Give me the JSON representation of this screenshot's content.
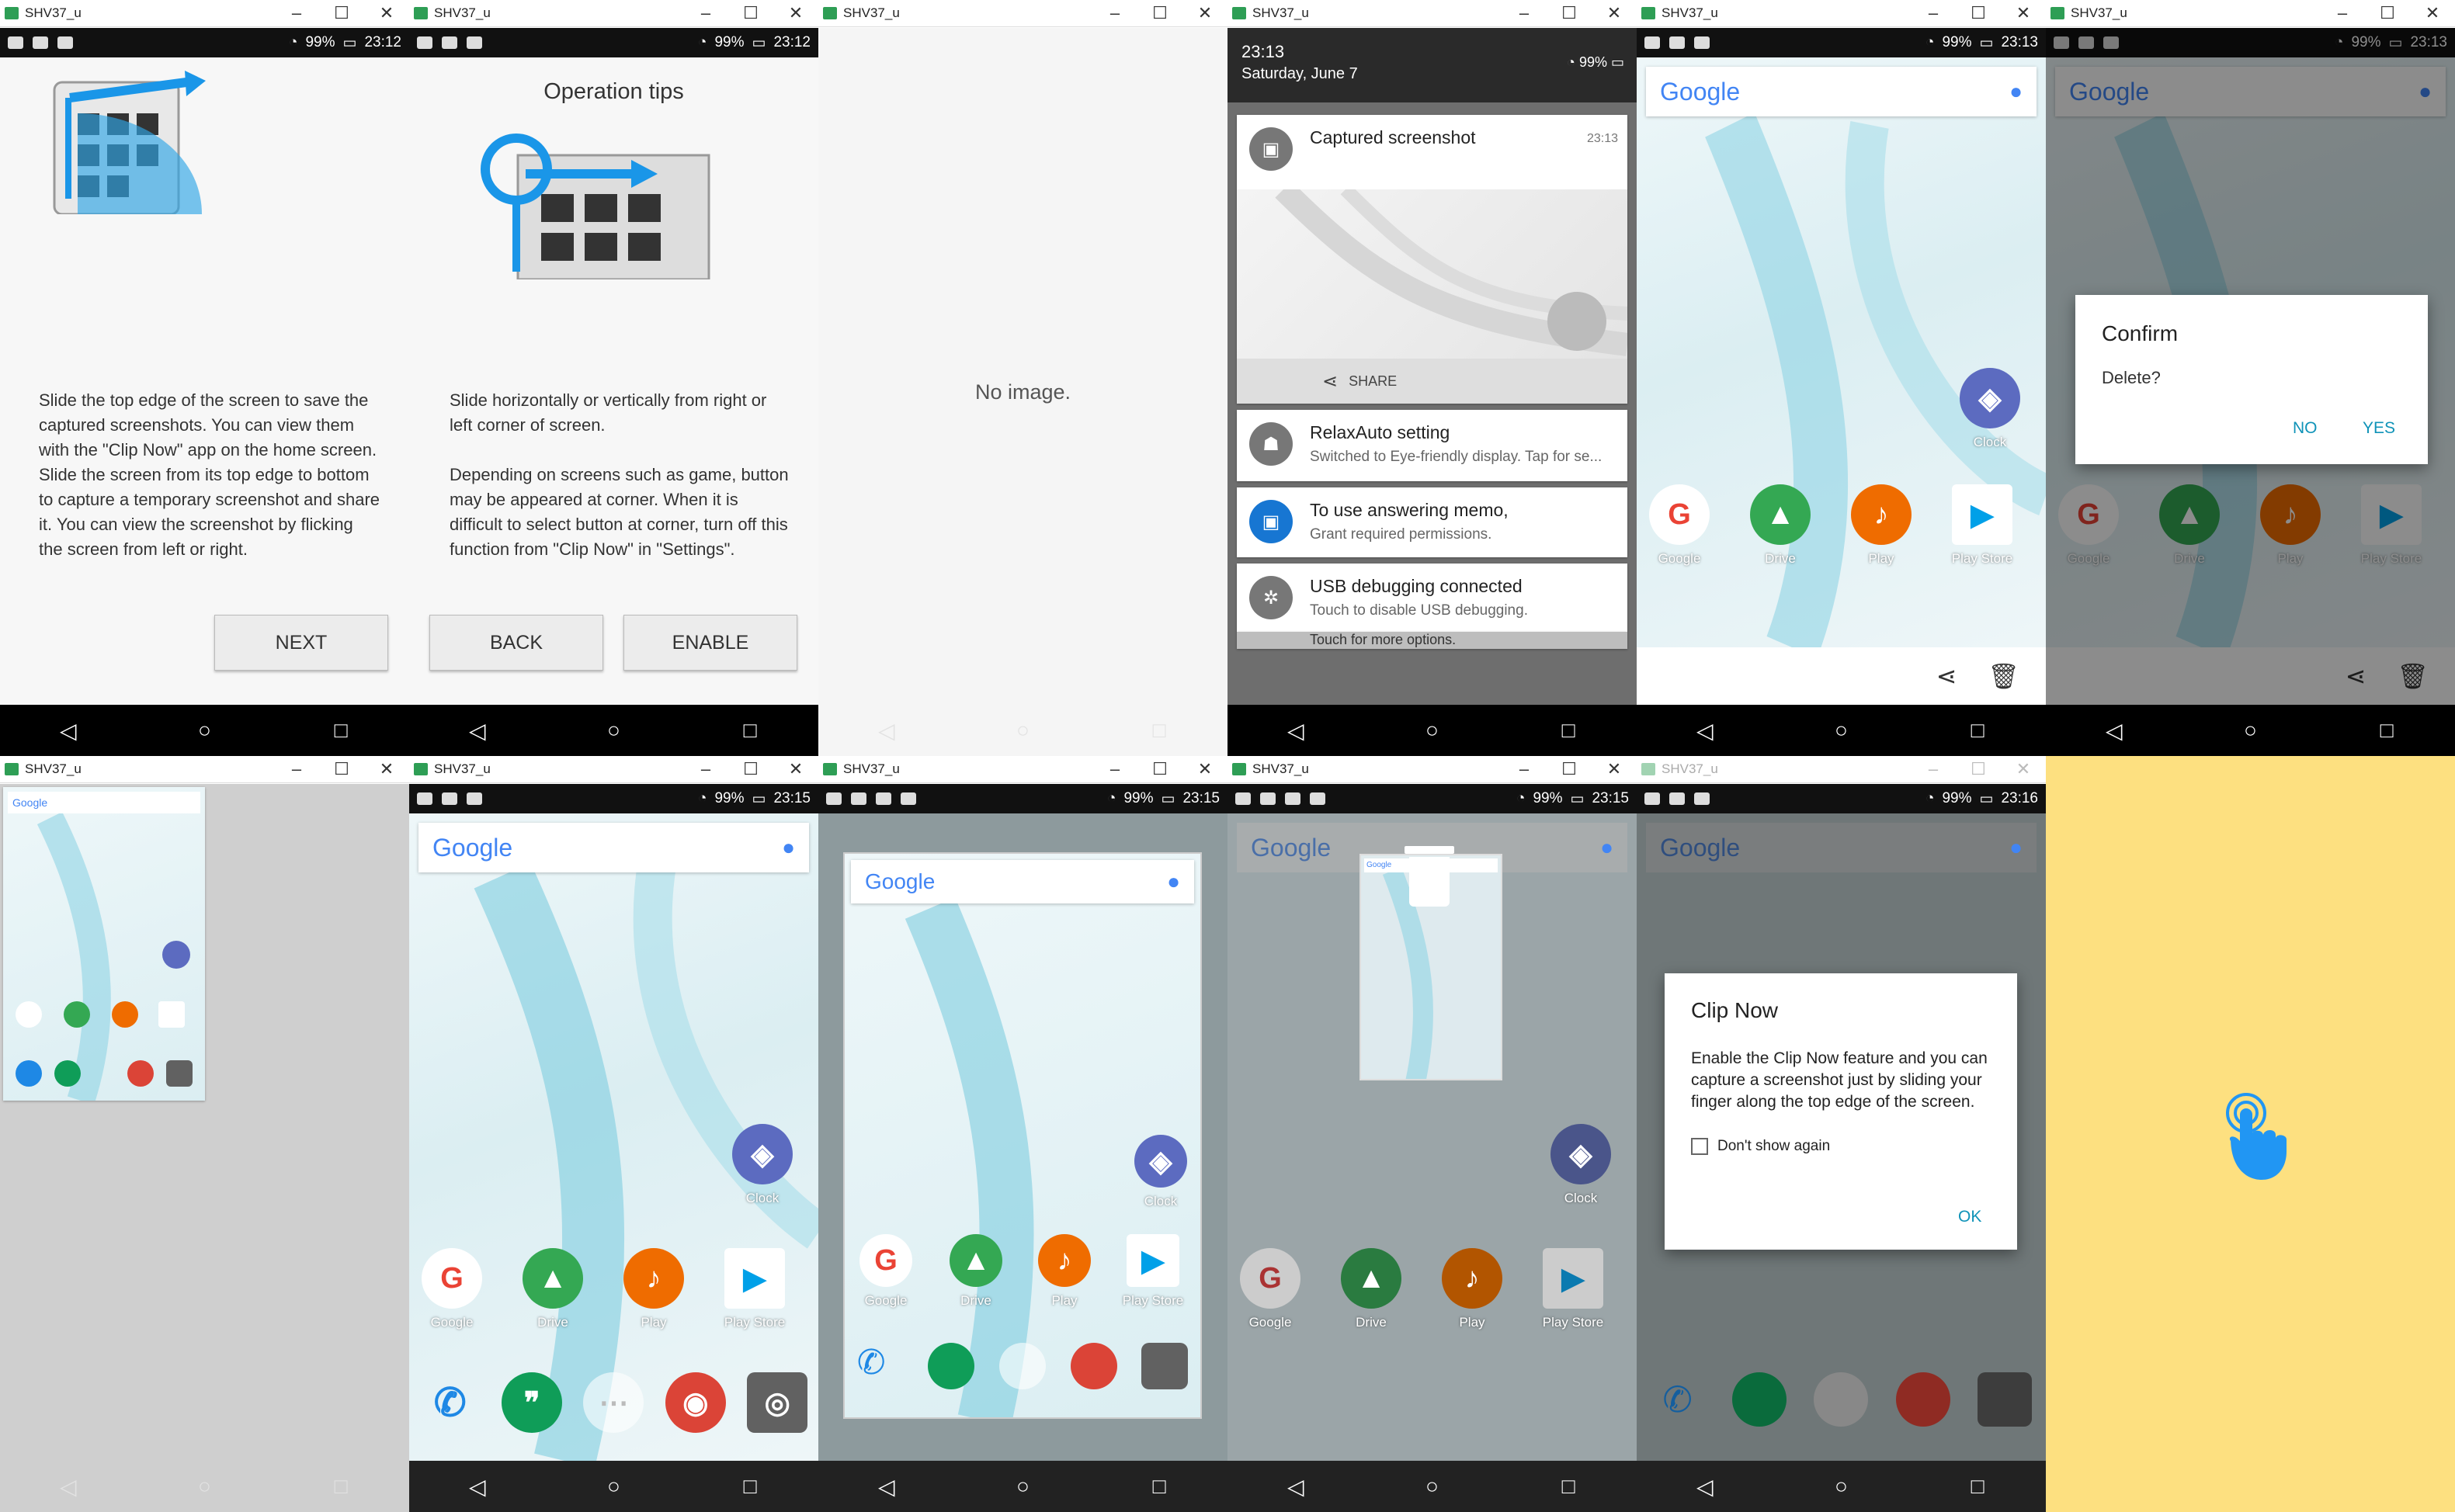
{
  "window": {
    "title": "SHV37_u",
    "min": "–",
    "max": "☐",
    "close": "✕"
  },
  "status": {
    "battery": "99%",
    "times": [
      "23:12",
      "23:12",
      "23:13",
      "23:13",
      "23:15",
      "23:15",
      "23:15",
      "23:16"
    ]
  },
  "nav": {
    "back": "◁",
    "home": "○",
    "recent": "□"
  },
  "p1": {
    "text": "Slide the top edge of the screen to save the captured screenshots. You can view them with the \"Clip Now\" app on the home screen. Slide the screen from its top edge to bottom to capture a temporary screenshot and share it. You can view the screenshot by flicking the screen from left or right.",
    "next": "NEXT"
  },
  "p2": {
    "title": "Operation tips",
    "text1": "Slide horizontally or vertically from right or left corner of screen.",
    "text2": "Depending on screens such as game, button may be appeared at corner. When it is difficult to select button at corner, turn off this function from \"Clip Now\" in \"Settings\".",
    "back": "BACK",
    "enable": "ENABLE"
  },
  "p3": {
    "empty": "No image."
  },
  "p4": {
    "time": "23:13",
    "date": "Saturday, June 7",
    "n1_title": "Captured screenshot",
    "n1_time": "23:13",
    "share": "SHARE",
    "n2_title": "RelaxAuto setting",
    "n2_sub": "Switched to Eye-friendly display. Tap for se...",
    "n3_title": "To use answering memo,",
    "n3_sub": "Grant required permissions.",
    "n4_title": "USB debugging connected",
    "n4_sub": "Touch to disable USB debugging.",
    "n5_sub": "Touch for more options."
  },
  "google": "Google",
  "apps": {
    "clock": "Clock",
    "google": "Google",
    "drive": "Drive",
    "play": "Play",
    "store": "Play Store"
  },
  "confirm": {
    "title": "Confirm",
    "text": "Delete?",
    "no": "NO",
    "yes": "YES"
  },
  "clip": {
    "title": "Clip Now",
    "text": "Enable the Clip Now feature and you can capture a screenshot just by sliding your finger along the top edge of the screen.",
    "check": "Don't show again",
    "ok": "OK"
  }
}
